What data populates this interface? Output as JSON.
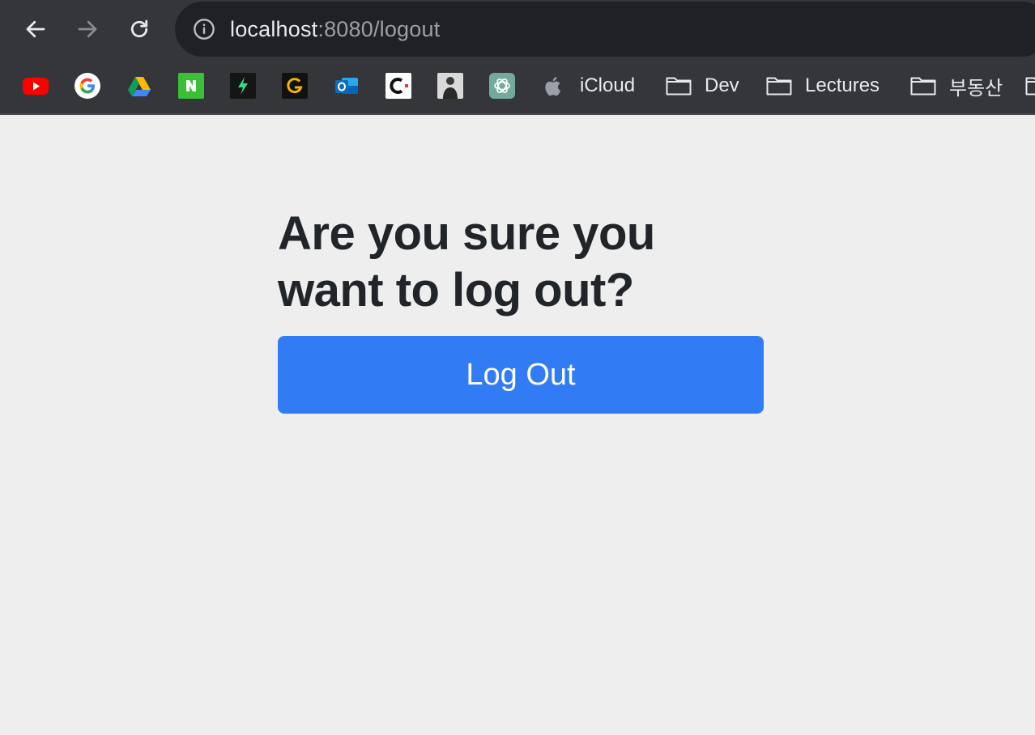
{
  "browser": {
    "url_host": "localhost",
    "url_rest": ":8080/logout",
    "nav_icons": [
      "back-arrow-icon",
      "forward-arrow-icon",
      "reload-icon",
      "info-icon"
    ]
  },
  "bookmarks": {
    "icon_items": [
      "youtube-icon",
      "google-icon",
      "google-drive-icon",
      "naver-icon",
      "green-bolt-icon",
      "gold-g-icon",
      "outlook-icon",
      "c-logo-icon",
      "profile-photo-icon",
      "chatgpt-icon",
      "apple-icon"
    ],
    "icloud_label": "iCloud",
    "folders": [
      {
        "label": "Dev"
      },
      {
        "label": "Lectures"
      },
      {
        "label": "부동산"
      }
    ]
  },
  "page": {
    "heading": "Are you sure you want to log out?",
    "button_label": "Log Out",
    "accent_color": "#317cf5",
    "background_color": "#eeeeee"
  }
}
